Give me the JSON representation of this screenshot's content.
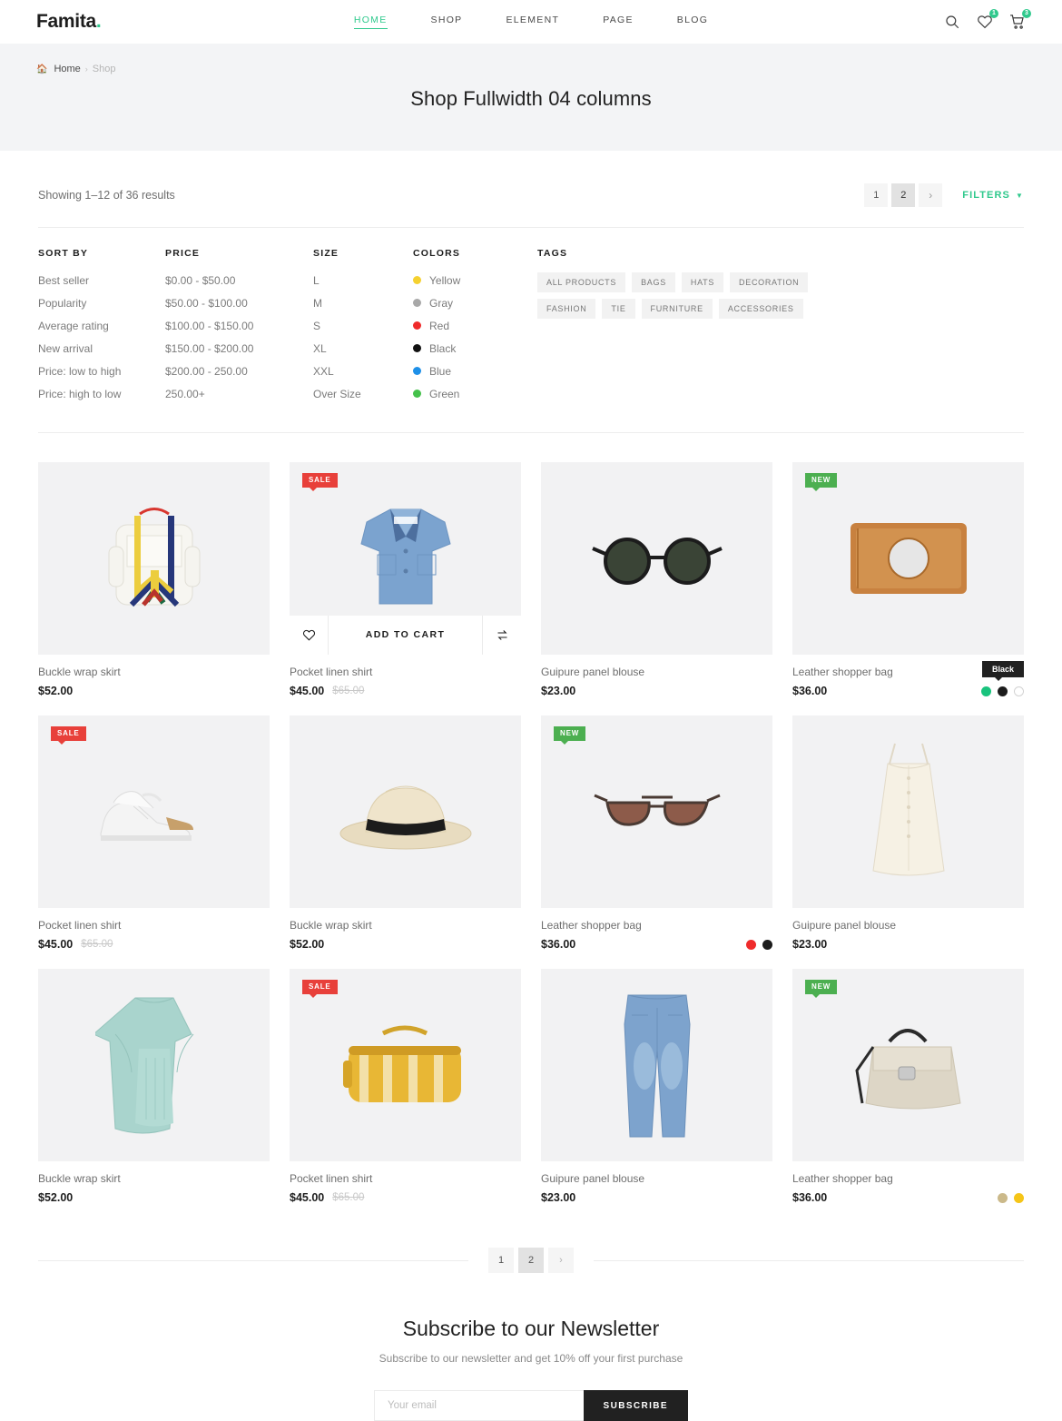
{
  "header": {
    "logo": "Famita",
    "logo_dot": ".",
    "nav": [
      {
        "label": "HOME",
        "active": true
      },
      {
        "label": "SHOP",
        "active": false
      },
      {
        "label": "ELEMENT",
        "active": false
      },
      {
        "label": "PAGE",
        "active": false
      },
      {
        "label": "BLOG",
        "active": false
      }
    ],
    "search_icon": "search-icon",
    "wishlist_icon": "heart-icon",
    "wishlist_count": "1",
    "cart_icon": "cart-icon",
    "cart_count": "3"
  },
  "banner": {
    "home_label": "Home",
    "separator": "›",
    "current": "Shop",
    "title": "Shop Fullwidth 04 columns"
  },
  "toolbar": {
    "result_count": "Showing 1–12 of 36 results",
    "pages": [
      "1",
      "2"
    ],
    "current_page": "2",
    "next_arrow": "›",
    "filters_label": "FILTERS",
    "filters_caret": "⌄"
  },
  "filters": {
    "sort_by": {
      "title": "SORT BY",
      "items": [
        "Best seller",
        "Popularity",
        "Average rating",
        "New arrival",
        "Price: low to high",
        "Price: high to low"
      ]
    },
    "price": {
      "title": "PRICE",
      "items": [
        "$0.00 - $50.00",
        "$50.00 - $100.00",
        "$100.00 - $150.00",
        "$150.00 - $200.00",
        "$200.00 - 250.00",
        "250.00+"
      ]
    },
    "size": {
      "title": "SIZE",
      "items": [
        "L",
        "M",
        "S",
        "XL",
        "XXL",
        "Over Size"
      ]
    },
    "colors": {
      "title": "COLORS",
      "items": [
        {
          "label": "Yellow",
          "hex": "#f5d130"
        },
        {
          "label": "Gray",
          "hex": "#a8a8a8"
        },
        {
          "label": "Red",
          "hex": "#ef2b2b"
        },
        {
          "label": "Black",
          "hex": "#111111"
        },
        {
          "label": "Blue",
          "hex": "#1e90e8"
        },
        {
          "label": "Green",
          "hex": "#45c14b"
        }
      ]
    },
    "tags": {
      "title": "TAGS",
      "items": [
        "ALL PRODUCTS",
        "BAGS",
        "HATS",
        "DECORATION",
        "FASHION",
        "TIE",
        "FURNITURE",
        "ACCESSORIES"
      ]
    }
  },
  "products": [
    {
      "name": "Buckle wrap skirt",
      "price": "$52.00",
      "old_price": null,
      "flag": null,
      "image": "backpack",
      "hover": false,
      "colors": [],
      "tooltip": null
    },
    {
      "name": "Pocket linen shirt",
      "price": "$45.00",
      "old_price": "$65.00",
      "flag": {
        "label": "SALE",
        "type": "sale"
      },
      "image": "shirt",
      "hover": true,
      "hover_wishlist_icon": "heart-icon",
      "hover_cart_label": "ADD TO CART",
      "hover_compare_icon": "compare-icon",
      "colors": [],
      "tooltip": null
    },
    {
      "name": "Guipure panel blouse",
      "price": "$23.00",
      "old_price": null,
      "flag": null,
      "image": "sunglasses-round",
      "hover": false,
      "colors": [],
      "tooltip": null
    },
    {
      "name": "Leather shopper bag",
      "price": "$36.00",
      "old_price": null,
      "flag": {
        "label": "NEW",
        "type": "new"
      },
      "image": "clutch",
      "hover": false,
      "colors": [
        {
          "hex": "#19c37d"
        },
        {
          "hex": "#1c1c1c"
        },
        {
          "hex": "#ffffff",
          "outline": true
        }
      ],
      "tooltip": "Black"
    },
    {
      "name": "Pocket linen shirt",
      "price": "$45.00",
      "old_price": "$65.00",
      "flag": {
        "label": "SALE",
        "type": "sale"
      },
      "image": "sneakers",
      "hover": false,
      "colors": [],
      "tooltip": null
    },
    {
      "name": "Buckle wrap skirt",
      "price": "$52.00",
      "old_price": null,
      "flag": null,
      "image": "fedora",
      "hover": false,
      "colors": [],
      "tooltip": null
    },
    {
      "name": "Leather shopper bag",
      "price": "$36.00",
      "old_price": null,
      "flag": {
        "label": "NEW",
        "type": "new"
      },
      "image": "sunglasses-aviator",
      "hover": false,
      "colors": [
        {
          "hex": "#ef2b2b"
        },
        {
          "hex": "#1c1c1c"
        }
      ],
      "tooltip": null
    },
    {
      "name": "Guipure panel blouse",
      "price": "$23.00",
      "old_price": null,
      "flag": null,
      "image": "dress-cream",
      "hover": false,
      "colors": [],
      "tooltip": null
    },
    {
      "name": "Buckle wrap skirt",
      "price": "$52.00",
      "old_price": null,
      "flag": null,
      "image": "dress-mint",
      "hover": false,
      "colors": [],
      "tooltip": null
    },
    {
      "name": "Pocket linen shirt",
      "price": "$45.00",
      "old_price": "$65.00",
      "flag": {
        "label": "SALE",
        "type": "sale"
      },
      "image": "duffel",
      "hover": false,
      "colors": [],
      "tooltip": null
    },
    {
      "name": "Guipure panel blouse",
      "price": "$23.00",
      "old_price": null,
      "flag": null,
      "image": "jeans",
      "hover": false,
      "colors": [],
      "tooltip": null
    },
    {
      "name": "Leather shopper bag",
      "price": "$36.00",
      "old_price": null,
      "flag": {
        "label": "NEW",
        "type": "new"
      },
      "image": "handbag",
      "hover": false,
      "colors": [
        {
          "hex": "#cbb98a"
        },
        {
          "hex": "#f5c518"
        }
      ],
      "tooltip": null
    }
  ],
  "bottom_pagination": {
    "pages": [
      "1",
      "2"
    ],
    "current_page": "2",
    "next_arrow": "›"
  },
  "newsletter": {
    "title": "Subscribe to our Newsletter",
    "subtitle": "Subscribe to our newsletter and get 10% off your first purchase",
    "placeholder": "Your email",
    "value": "",
    "button_label": "SUBSCRIBE"
  }
}
